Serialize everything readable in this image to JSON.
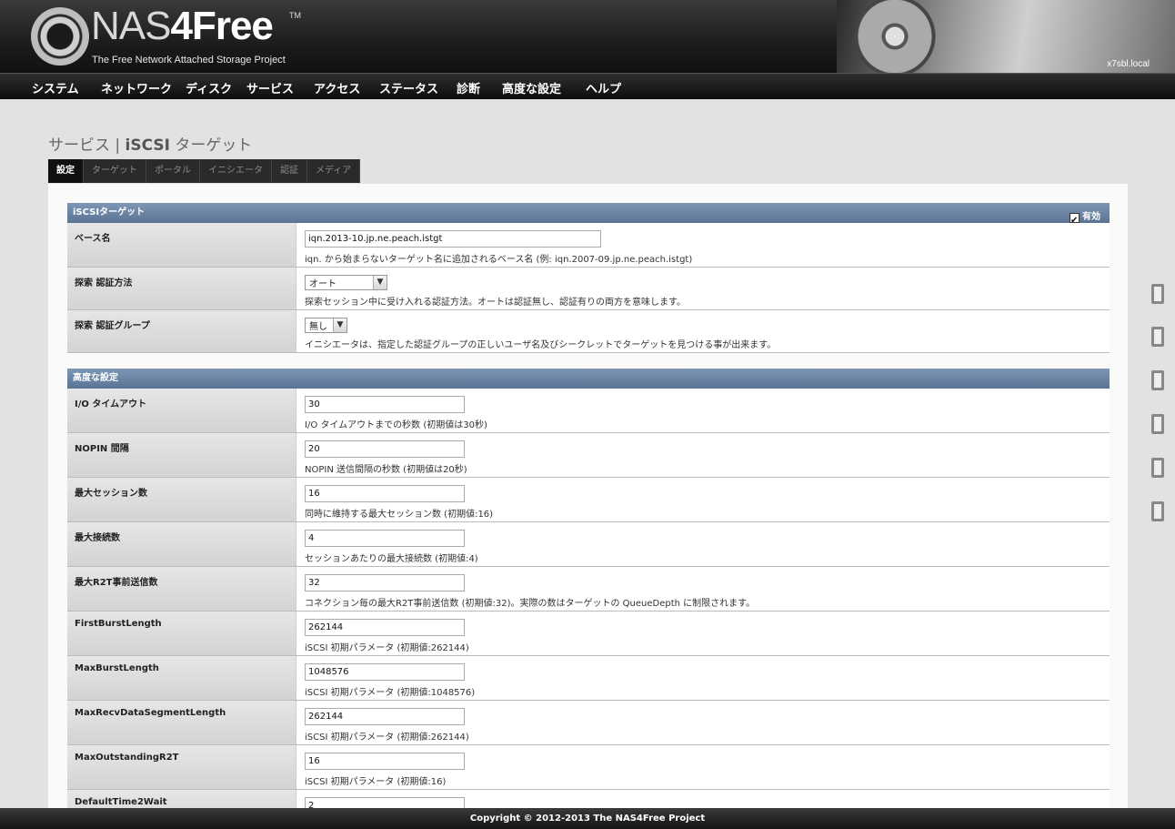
{
  "header": {
    "logo_main": "NAS",
    "logo_accent": "4Free",
    "logo_tm": "TM",
    "subtitle": "The Free Network Attached Storage Project",
    "hostname": "x7sbl.local"
  },
  "nav": [
    "システム",
    "ネットワーク",
    "ディスク",
    "サービス",
    "アクセス",
    "ステータス",
    "診断",
    "高度な設定",
    "ヘルプ"
  ],
  "page": {
    "title_prefix": "サービス | ",
    "title_main": "iSCSI",
    "title_suffix": " ターゲット"
  },
  "tabs": [
    "設定",
    "ターゲット",
    "ポータル",
    "イニシエータ",
    "認証",
    "メディア"
  ],
  "target_section": {
    "title": "iSCSIターゲット",
    "enable_label": "有効",
    "enabled": true
  },
  "base_name": {
    "label": "ベース名",
    "value": "iqn.2013-10.jp.ne.peach.istgt",
    "desc": "iqn. から始まらないターゲット名に追加されるベース名 (例: iqn.2007-09.jp.ne.peach.istgt)"
  },
  "discovery_auth": {
    "label": "探索 認証方法",
    "value": "オート",
    "desc": "探索セッション中に受け入れる認証方法。オートは認証無し、認証有りの両方を意味します。"
  },
  "discovery_group": {
    "label": "探索 認証グループ",
    "value": "無し",
    "desc": "イニシエータは、指定した認証グループの正しいユーザ名及びシークレットでターゲットを見つける事が出来ます。"
  },
  "advanced_section": {
    "title": "高度な設定"
  },
  "advanced": [
    {
      "label": "I/O タイムアウト",
      "value": "30",
      "desc": "I/O タイムアウトまでの秒数 (初期値は30秒)"
    },
    {
      "label": "NOPIN 間隔",
      "value": "20",
      "desc": "NOPIN 送信間隔の秒数 (初期値は20秒)"
    },
    {
      "label": "最大セッション数",
      "value": "16",
      "desc": "同時に維持する最大セッション数 (初期値:16)"
    },
    {
      "label": "最大接続数",
      "value": "4",
      "desc": "セッションあたりの最大接続数 (初期値:4)"
    },
    {
      "label": "最大R2T事前送信数",
      "value": "32",
      "desc": "コネクション毎の最大R2T事前送信数 (初期値:32)。実際の数はターゲットの QueueDepth に制限されます。"
    },
    {
      "label": "FirstBurstLength",
      "value": "262144",
      "desc": "iSCSI 初期パラメータ (初期値:262144)"
    },
    {
      "label": "MaxBurstLength",
      "value": "1048576",
      "desc": "iSCSI 初期パラメータ (初期値:1048576)"
    },
    {
      "label": "MaxRecvDataSegmentLength",
      "value": "262144",
      "desc": "iSCSI 初期パラメータ (初期値:262144)"
    },
    {
      "label": "MaxOutstandingR2T",
      "value": "16",
      "desc": "iSCSI 初期パラメータ (初期値:16)"
    },
    {
      "label": "DefaultTime2Wait",
      "value": "2",
      "desc": ""
    }
  ],
  "footer": "Copyright © 2012-2013 The NAS4Free Project"
}
